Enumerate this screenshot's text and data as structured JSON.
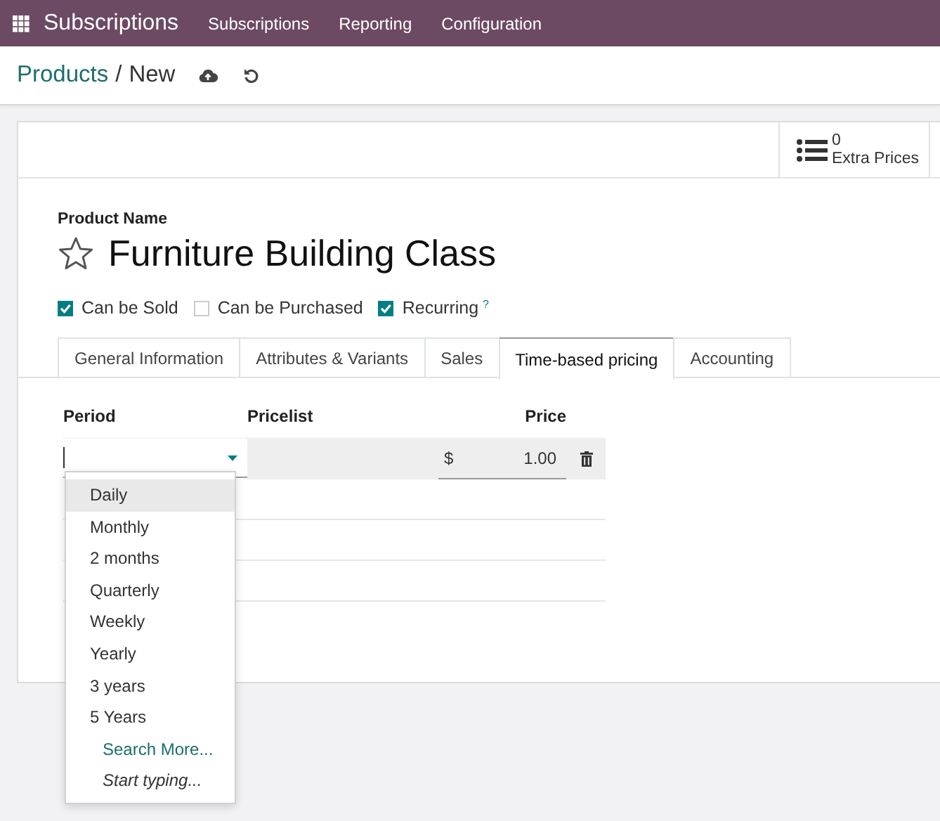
{
  "app": {
    "name": "Subscriptions",
    "menu": [
      "Subscriptions",
      "Reporting",
      "Configuration"
    ]
  },
  "breadcrumb": {
    "parent": "Products",
    "separator": "/",
    "current": "New"
  },
  "stat_button": {
    "value": "0",
    "label": "Extra Prices"
  },
  "product": {
    "name_label": "Product Name",
    "name": "Furniture Building Class",
    "favorite": false
  },
  "options": [
    {
      "label": "Can be Sold",
      "checked": true
    },
    {
      "label": "Can be Purchased",
      "checked": false
    },
    {
      "label": "Recurring",
      "checked": true,
      "help": "?"
    }
  ],
  "tabs": [
    {
      "label": "General Information",
      "selected": false
    },
    {
      "label": "Attributes & Variants",
      "selected": false
    },
    {
      "label": "Sales",
      "selected": false
    },
    {
      "label": "Time-based pricing",
      "selected": true
    },
    {
      "label": "Accounting",
      "selected": false
    }
  ],
  "pricing_table": {
    "columns": [
      "Period",
      "Pricelist",
      "Price"
    ],
    "rows": [
      {
        "currency": "$",
        "price": "1.00"
      }
    ]
  },
  "dropdown": {
    "items": [
      {
        "label": "Daily",
        "kind": "option",
        "selected": true
      },
      {
        "label": "Monthly",
        "kind": "option",
        "selected": false
      },
      {
        "label": "2 months",
        "kind": "option",
        "selected": false
      },
      {
        "label": "Quarterly",
        "kind": "option",
        "selected": false
      },
      {
        "label": "Weekly",
        "kind": "option",
        "selected": false
      },
      {
        "label": "Yearly",
        "kind": "option",
        "selected": false
      },
      {
        "label": "3 years",
        "kind": "option",
        "selected": false
      },
      {
        "label": "5 Years",
        "kind": "option",
        "selected": false
      },
      {
        "label": "Search More...",
        "kind": "link",
        "selected": false
      },
      {
        "label": "Start typing...",
        "kind": "hint",
        "selected": false
      }
    ]
  }
}
